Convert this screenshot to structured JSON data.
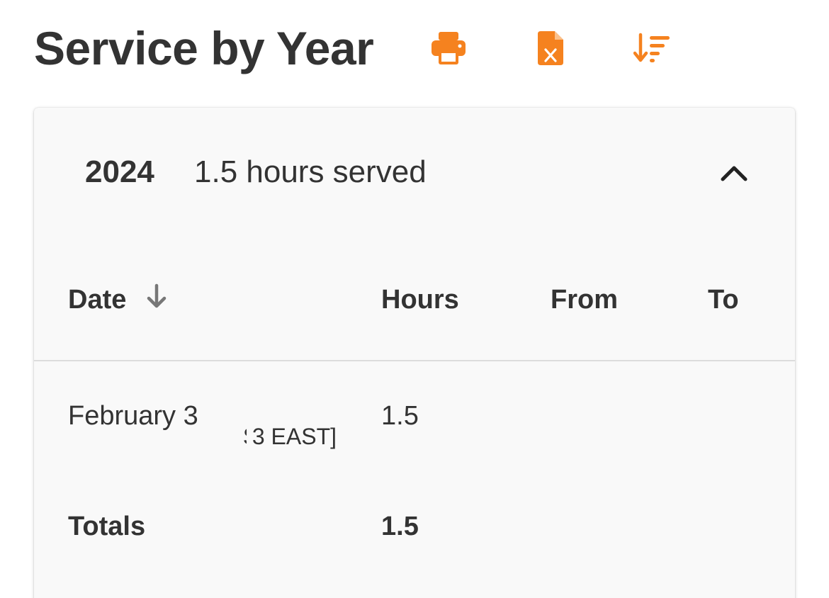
{
  "header": {
    "title": "Service by Year",
    "actions": [
      {
        "name": "print-icon",
        "label": "Print"
      },
      {
        "name": "excel-export-icon",
        "label": "Export to Excel"
      },
      {
        "name": "sort-descending-icon",
        "label": "Sort"
      }
    ],
    "accent_color": "#f5821f"
  },
  "panel": {
    "year": "2024",
    "summary": "1.5 hours served",
    "expanded": true,
    "chevron_icon": "chevron-up-icon"
  },
  "table": {
    "columns": {
      "date": "Date",
      "hours": "Hours",
      "from": "From",
      "to": "To"
    },
    "sort_icon": "arrow-down-icon",
    "rows": [
      {
        "date": "February 3",
        "location_fragment": "3 EAST]",
        "hours": "1.5",
        "from": "",
        "to": ""
      }
    ],
    "totals": {
      "label": "Totals",
      "hours": "1.5"
    }
  }
}
